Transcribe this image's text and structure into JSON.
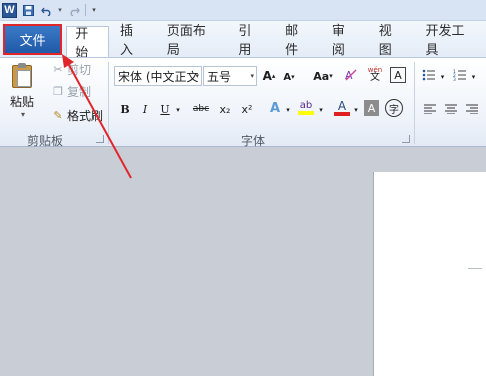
{
  "quick_access": {
    "app_badge": "W"
  },
  "tabs": [
    "文件",
    "开始",
    "插入",
    "页面布局",
    "引用",
    "邮件",
    "审阅",
    "视图",
    "开发工具"
  ],
  "clipboard": {
    "paste": "粘贴",
    "cut": "剪切",
    "copy": "复制",
    "format_painter": "格式刷",
    "group_label": "剪贴板"
  },
  "font": {
    "font_name": "宋体 (中文正文",
    "font_size": "五号",
    "group_label": "字体",
    "grow": "A",
    "shrink": "A",
    "case": "Aa",
    "pinyin": "wén",
    "char_border": "A",
    "bold": "B",
    "italic": "I",
    "underline": "U",
    "strike": "abc",
    "subscript": "x₂",
    "superscript": "x²",
    "text_effect": "A",
    "highlight": "ab",
    "font_color": "A",
    "char_shading": "A",
    "enclose": "字"
  },
  "colors": {
    "file_tab": "#2b6cc0",
    "annotation_red": "#e0262a",
    "highlight_yellow": "#ffff00",
    "font_color_red": "#e02020"
  }
}
